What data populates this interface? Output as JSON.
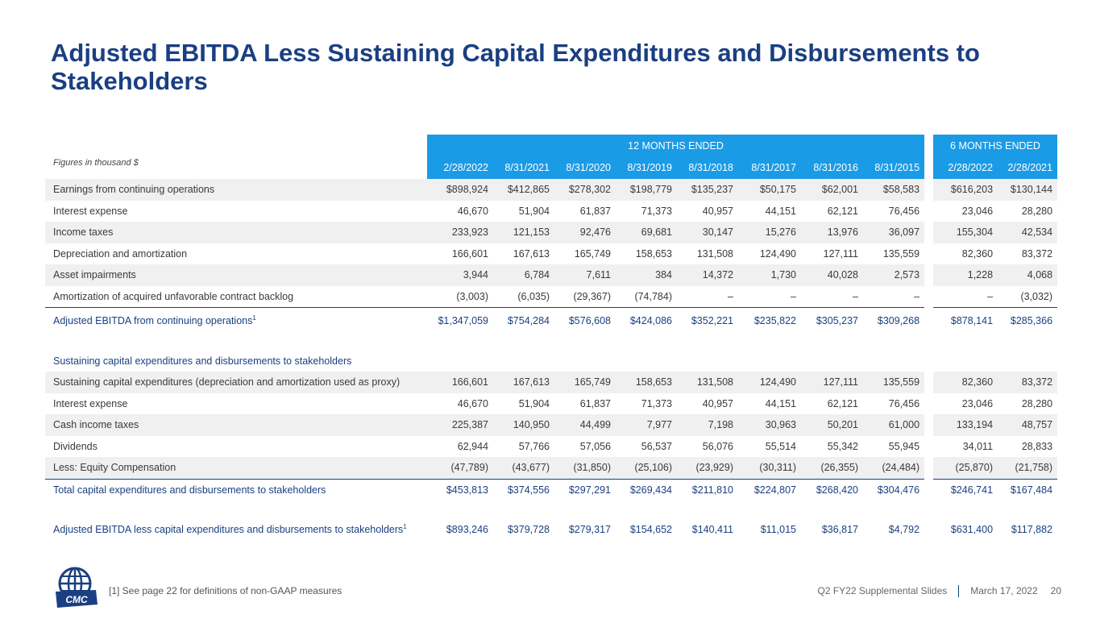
{
  "title": "Adjusted EBITDA Less Sustaining Capital Expenditures and Disbursements to Stakeholders",
  "table": {
    "figures_note": "Figures in thousand $",
    "group_12": "12 MONTHS ENDED",
    "group_6": "6 MONTHS ENDED",
    "dates": [
      "2/28/2022",
      "8/31/2021",
      "8/31/2020",
      "8/31/2019",
      "8/31/2018",
      "8/31/2017",
      "8/31/2016",
      "8/31/2015",
      "2/28/2022",
      "2/28/2021"
    ],
    "rows": [
      {
        "label": "Earnings from continuing operations",
        "values": [
          "$898,924",
          "$412,865",
          "$278,302",
          "$198,779",
          "$135,237",
          "$50,175",
          "$62,001",
          "$58,583",
          "$616,203",
          "$130,144"
        ]
      },
      {
        "label": "Interest expense",
        "values": [
          "46,670",
          "51,904",
          "61,837",
          "71,373",
          "40,957",
          "44,151",
          "62,121",
          "76,456",
          "23,046",
          "28,280"
        ]
      },
      {
        "label": "Income taxes",
        "values": [
          "233,923",
          "121,153",
          "92,476",
          "69,681",
          "30,147",
          "15,276",
          "13,976",
          "36,097",
          "155,304",
          "42,534"
        ]
      },
      {
        "label": "Depreciation and amortization",
        "values": [
          "166,601",
          "167,613",
          "165,749",
          "158,653",
          "131,508",
          "124,490",
          "127,111",
          "135,559",
          "82,360",
          "83,372"
        ]
      },
      {
        "label": "Asset impairments",
        "values": [
          "3,944",
          "6,784",
          "7,611",
          "384",
          "14,372",
          "1,730",
          "40,028",
          "2,573",
          "1,228",
          "4,068"
        ]
      },
      {
        "label": "Amortization of acquired unfavorable contract backlog",
        "values": [
          "(3,003)",
          "(6,035)",
          "(29,367)",
          "(74,784)",
          "–",
          "–",
          "–",
          "–",
          "–",
          "(3,032)"
        ]
      }
    ],
    "adj_ebitda": {
      "label": "Adjusted EBITDA from continuing operations",
      "footnote": "1",
      "values": [
        "$1,347,059",
        "$754,284",
        "$576,608",
        "$424,086",
        "$352,221",
        "$235,822",
        "$305,237",
        "$309,268",
        "$878,141",
        "$285,366"
      ]
    },
    "section_heading": "Sustaining capital expenditures and disbursements to stakeholders",
    "rows2": [
      {
        "label": "Sustaining capital expenditures (depreciation and amortization used as proxy)",
        "values": [
          "166,601",
          "167,613",
          "165,749",
          "158,653",
          "131,508",
          "124,490",
          "127,111",
          "135,559",
          "82,360",
          "83,372"
        ]
      },
      {
        "label": "Interest expense",
        "values": [
          "46,670",
          "51,904",
          "61,837",
          "71,373",
          "40,957",
          "44,151",
          "62,121",
          "76,456",
          "23,046",
          "28,280"
        ]
      },
      {
        "label": "Cash income taxes",
        "values": [
          "225,387",
          "140,950",
          "44,499",
          "7,977",
          "7,198",
          "30,963",
          "50,201",
          "61,000",
          "133,194",
          "48,757"
        ]
      },
      {
        "label": "Dividends",
        "values": [
          "62,944",
          "57,766",
          "57,056",
          "56,537",
          "56,076",
          "55,514",
          "55,342",
          "55,945",
          "34,011",
          "28,833"
        ]
      },
      {
        "label": "Less: Equity Compensation",
        "values": [
          "(47,789)",
          "(43,677)",
          "(31,850)",
          "(25,106)",
          "(23,929)",
          "(30,311)",
          "(26,355)",
          "(24,484)",
          "(25,870)",
          "(21,758)"
        ]
      }
    ],
    "total": {
      "label": "Total capital expenditures and disbursements to stakeholders",
      "values": [
        "$453,813",
        "$374,556",
        "$297,291",
        "$269,434",
        "$211,810",
        "$224,807",
        "$268,420",
        "$304,476",
        "$246,741",
        "$167,484"
      ]
    },
    "final": {
      "label": "Adjusted EBITDA less capital expenditures and disbursements to stakeholders",
      "footnote": "1",
      "values": [
        "$893,246",
        "$379,728",
        "$279,317",
        "$154,652",
        "$140,411",
        "$11,015",
        "$36,817",
        "$4,792",
        "$631,400",
        "$117,882"
      ]
    }
  },
  "footer": {
    "note": "[1] See page 22 for definitions of non-GAAP measures",
    "deck": "Q2 FY22 Supplemental Slides",
    "date": "March 17, 2022",
    "page": "20",
    "logo_text": "CMC"
  },
  "colors": {
    "navy": "#1a3f82",
    "band": "#1a9be6",
    "shade": "#f0f0f0"
  }
}
